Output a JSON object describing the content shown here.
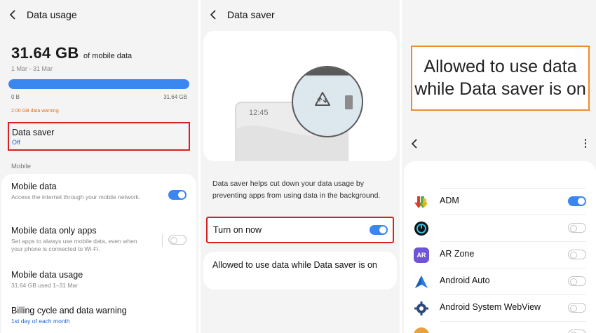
{
  "colors": {
    "accent": "#3b87f0",
    "link_blue": "#1a64d8",
    "warning": "#e07020",
    "highlight_red": "#d82020",
    "highlight_orange": "#f08a2c",
    "background": "#f4f4f4"
  },
  "panel1": {
    "header": {
      "back_icon": "back-arrow-icon",
      "title": "Data usage"
    },
    "usage": {
      "amount": "31.64 GB",
      "unit_label": "of mobile data",
      "date_range": "1 Mar - 31 Mar",
      "progress": 1.0,
      "min_label": "0 B",
      "max_label": "31.64 GB",
      "warning": "2.00 GB data warning"
    },
    "data_saver": {
      "title": "Data saver",
      "status": "Off"
    },
    "section_label": "Mobile",
    "rows": [
      {
        "title": "Mobile data",
        "desc": "Access the internet through your mobile network.",
        "toggle": "on"
      },
      {
        "title": "Mobile data only apps",
        "desc": "Set apps to always use mobile data, even when your phone is connected to Wi-Fi.",
        "toggle": "off"
      },
      {
        "title": "Mobile data usage",
        "desc": "31.64 GB used 1–31 Mar"
      },
      {
        "title": "Billing cycle and data warning",
        "desc": "1st day of each month"
      }
    ]
  },
  "panel2": {
    "header": {
      "back_icon": "back-arrow-icon",
      "title": "Data saver"
    },
    "illustration": {
      "clock": "12:45",
      "icon": "data-saver-icon"
    },
    "description": "Data saver helps cut down your data usage by preventing apps from using data in the background.",
    "turn_on": {
      "label": "Turn on now",
      "toggle": "on"
    },
    "allowed": {
      "label": "Allowed to use data while Data saver is on"
    }
  },
  "panel3": {
    "callout": "Allowed to use data while Data saver is on",
    "header": {
      "back_icon": "back-arrow-icon",
      "more_icon": "more-options-icon"
    },
    "apps": [
      {
        "name": "ADM",
        "icon": "adm-icon",
        "toggle": "on"
      },
      {
        "name": "",
        "icon": "timer-app-icon",
        "toggle": "off"
      },
      {
        "name": "AR Zone",
        "icon": "ar-zone-icon",
        "icon_text": "AR",
        "toggle": "off"
      },
      {
        "name": "Android Auto",
        "icon": "android-auto-icon",
        "toggle": "off"
      },
      {
        "name": "Android System WebView",
        "icon": "webview-gear-icon",
        "toggle": "off"
      },
      {
        "name": "",
        "icon": "partial-app-icon",
        "toggle": "off"
      }
    ]
  }
}
